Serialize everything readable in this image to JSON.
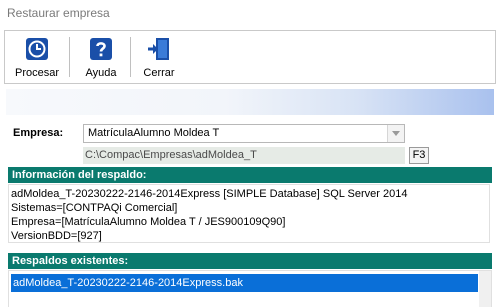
{
  "window": {
    "title": "Restaurar empresa"
  },
  "toolbar": {
    "procesar": {
      "label": "Procesar",
      "icon": "clock-icon"
    },
    "ayuda": {
      "label": "Ayuda",
      "icon": "help-icon"
    },
    "cerrar": {
      "label": "Cerrar",
      "icon": "exit-door-icon"
    }
  },
  "empresa": {
    "label": "Empresa:",
    "selected": "MatrículaAlumno Moldea T",
    "path": "C:\\Compac\\Empresas\\adMoldea_T",
    "f3_label": "F3"
  },
  "info": {
    "header": "Información del respaldo:",
    "lines": [
      "adMoldea_T-20230222-2146-2014Express [SIMPLE Database] SQL Server 2014",
      "Sistemas=[CONTPAQi Comercial]",
      "Empresa=[MatrículaAlumno Moldea T / JES900109Q90]",
      "VersionBDD=[927]"
    ]
  },
  "backups": {
    "header": "Respaldos existentes:",
    "items": [
      "adMoldea_T-20230222-2146-2014Express.bak"
    ]
  },
  "colors": {
    "section_header": "#0a7a6e",
    "selection": "#0a6fd8"
  }
}
